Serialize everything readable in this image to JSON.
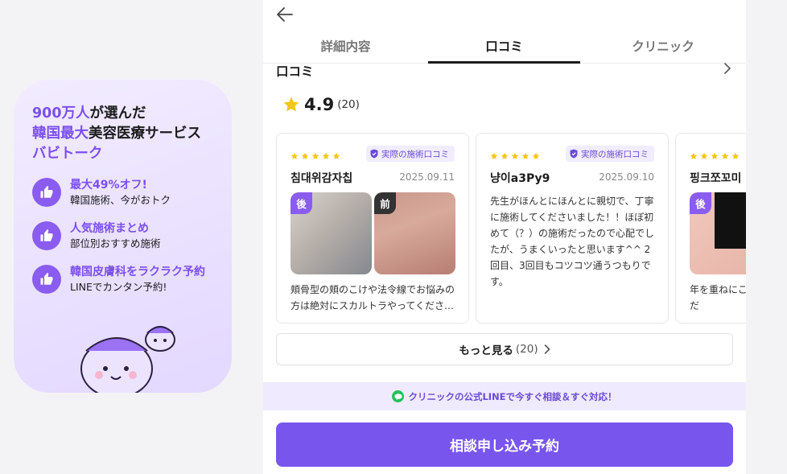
{
  "promo": {
    "head_line1_hl": "900万人",
    "head_line1_rest": "が選んだ",
    "head_line2_hl": "韓国最大",
    "head_line2_rest": "美容医療サービス",
    "head_line3": "バビトーク",
    "benefits": [
      {
        "title": "最大49%オフ!",
        "sub": "韓国施術、今がおトク"
      },
      {
        "title": "人気施術まとめ",
        "sub": "部位別おすすめ施術"
      },
      {
        "title": "韓国皮膚科をラクラク予約",
        "sub": "LINEでカンタン予約!"
      }
    ]
  },
  "tabs": [
    "詳細内容",
    "口コミ",
    "クリニック"
  ],
  "section": {
    "title": "口コミ"
  },
  "rating": {
    "score": "4.9",
    "count": "(20)"
  },
  "reviews": [
    {
      "badge": "実際の施術口コミ",
      "name": "침대위감자칩",
      "date": "2025.09.11",
      "after_tag": "後",
      "before_tag": "前",
      "body": "頬骨型の頬のこけや法令線でお悩みの方は絶対にスカルトラやってくださ…"
    },
    {
      "badge": "実際の施術口コミ",
      "name": "냥이a3Py9",
      "date": "2025.09.10",
      "body": "先生がほんとにほんとに親切で、丁寧に施術してくださいました！！ほぼ初めて（？）の施術だったので心配でしたが、うまくいったと思います^^ 2回目、3回目もコツコツ通うつもりです。"
    },
    {
      "name": "핑크쪼꼬미",
      "after_tag": "後",
      "body": "年を重ねにこけがだんだ"
    }
  ],
  "more": {
    "label": "もっと見る",
    "count": "(20)"
  },
  "banner": "クリニックの公式LINEで今すぐ相談＆すぐ対応！",
  "cta": "相談申し込み予約",
  "colors": {
    "accent": "#7856ee",
    "star": "#f5c518",
    "line_green": "#23c15a"
  }
}
